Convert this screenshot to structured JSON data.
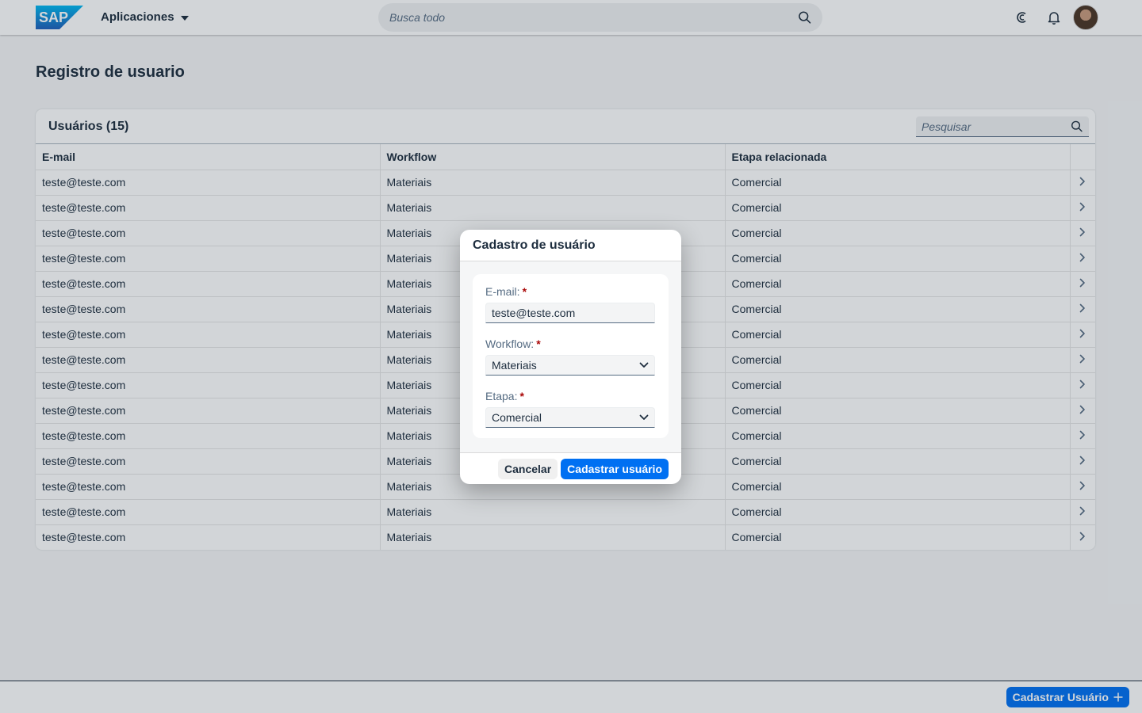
{
  "shell": {
    "logo_text": "SAP",
    "apps_label": "Aplicaciones",
    "search_placeholder": "Busca todo"
  },
  "page": {
    "title": "Registro de usuario"
  },
  "table": {
    "title": "Usuários (15)",
    "search_placeholder": "Pesquisar",
    "columns": [
      "E-mail",
      "Workflow",
      "Etapa relacionada"
    ],
    "rows": [
      [
        "teste@teste.com",
        "Materiais",
        "Comercial"
      ],
      [
        "teste@teste.com",
        "Materiais",
        "Comercial"
      ],
      [
        "teste@teste.com",
        "Materiais",
        "Comercial"
      ],
      [
        "teste@teste.com",
        "Materiais",
        "Comercial"
      ],
      [
        "teste@teste.com",
        "Materiais",
        "Comercial"
      ],
      [
        "teste@teste.com",
        "Materiais",
        "Comercial"
      ],
      [
        "teste@teste.com",
        "Materiais",
        "Comercial"
      ],
      [
        "teste@teste.com",
        "Materiais",
        "Comercial"
      ],
      [
        "teste@teste.com",
        "Materiais",
        "Comercial"
      ],
      [
        "teste@teste.com",
        "Materiais",
        "Comercial"
      ],
      [
        "teste@teste.com",
        "Materiais",
        "Comercial"
      ],
      [
        "teste@teste.com",
        "Materiais",
        "Comercial"
      ],
      [
        "teste@teste.com",
        "Materiais",
        "Comercial"
      ],
      [
        "teste@teste.com",
        "Materiais",
        "Comercial"
      ],
      [
        "teste@teste.com",
        "Materiais",
        "Comercial"
      ]
    ]
  },
  "dialog": {
    "title": "Cadastro de usuário",
    "email_label": "E-mail:",
    "email_value": "teste@teste.com",
    "workflow_label": "Workflow:",
    "workflow_value": "Materiais",
    "etapa_label": "Etapa:",
    "etapa_value": "Comercial",
    "required_mark": "*",
    "cancel_label": "Cancelar",
    "submit_label": "Cadastrar usuário"
  },
  "footer": {
    "add_button_label": "Cadastrar Usuário"
  },
  "colors": {
    "brand_blue": "#0070f2",
    "required_red": "#aa0808",
    "text": "#1d2d3e"
  }
}
